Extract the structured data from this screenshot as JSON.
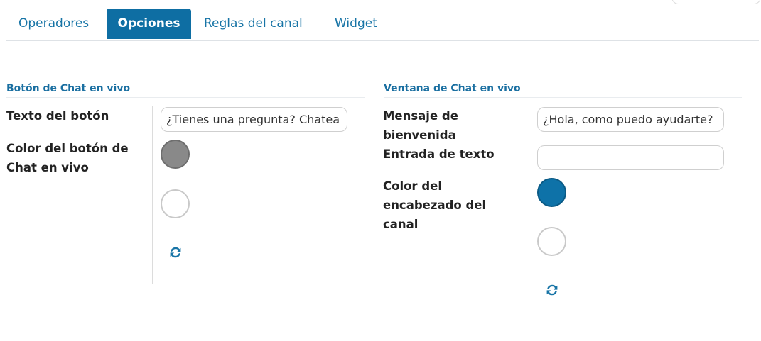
{
  "tabs": [
    {
      "label": "Operadores",
      "active": false
    },
    {
      "label": "Opciones",
      "active": true
    },
    {
      "label": "Reglas del canal",
      "active": false
    },
    {
      "label": "Widget",
      "active": false
    }
  ],
  "chat_button": {
    "section_title": "Botón de Chat en vivo",
    "text_label": "Texto del botón",
    "text_value": "¿Tienes una pregunta? Chatea con nosotros",
    "color_label_line1": "Color del botón de",
    "color_label_line2": "Chat en vivo",
    "color_value": "#898989",
    "refresh_icon": "refresh-icon"
  },
  "chat_window": {
    "section_title": "Ventana de Chat en vivo",
    "welcome_label_line1": "Mensaje de",
    "welcome_label_line2": "bienvenida",
    "welcome_value": "¿Hola, como puedo ayudarte?",
    "input_label": "Entrada de texto",
    "input_value": "",
    "header_color_label_line1": "Color del",
    "header_color_label_line2": "encabezado del",
    "header_color_label_line3": "canal",
    "header_color_value": "#0e72a8",
    "refresh_icon": "refresh-icon"
  },
  "colors": {
    "accent": "#0e6ea3",
    "tab_text": "#1774a6",
    "section_title": "#1a6fa1"
  }
}
